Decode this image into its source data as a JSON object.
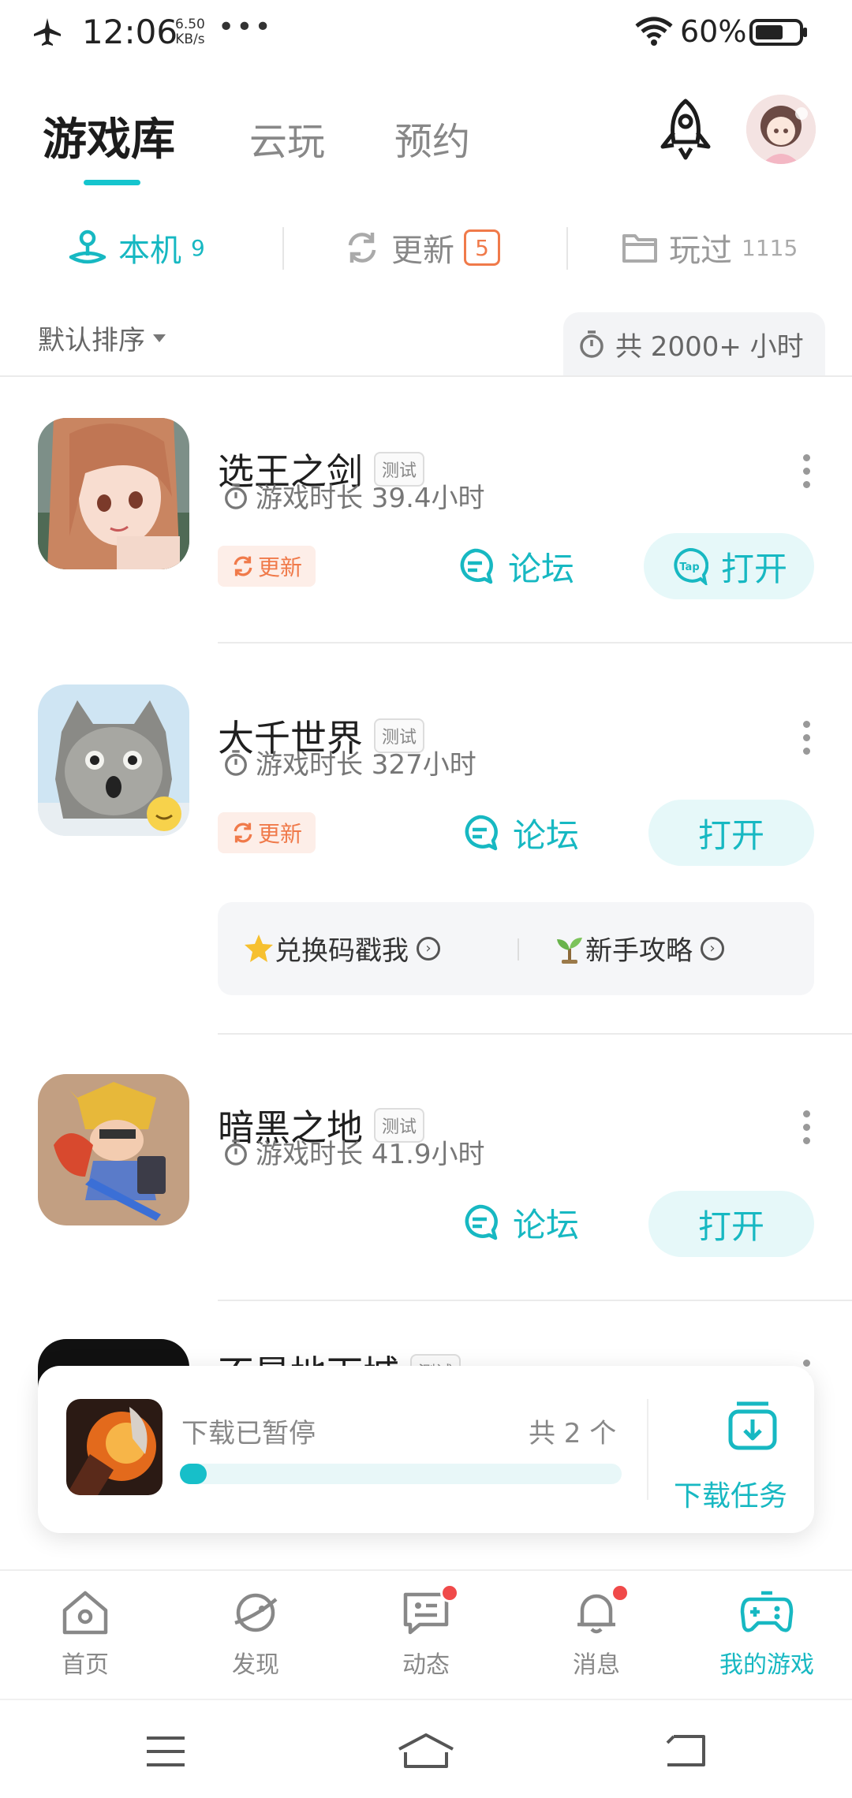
{
  "status_bar": {
    "time": "12:06",
    "net_speed_value": "6.50",
    "net_speed_unit": "KB/s",
    "more": "•••",
    "battery_percent": "60%"
  },
  "header": {
    "tabs": [
      {
        "label": "游戏库",
        "active": true
      },
      {
        "label": "云玩",
        "active": false
      },
      {
        "label": "预约",
        "active": false
      }
    ],
    "icons": {
      "launch": "rocket-icon",
      "avatar": "user-avatar"
    }
  },
  "sub_tabs": {
    "local": {
      "label": "本机",
      "count": "9"
    },
    "update": {
      "label": "更新",
      "count": "5"
    },
    "played": {
      "label": "玩过",
      "count": "1115"
    }
  },
  "sort": {
    "label": "默认排序",
    "total_time": "共 2000+ 小时"
  },
  "games": [
    {
      "name": "选王之剑",
      "tag": "测试",
      "playtime": "游戏时长 39.4小时",
      "update_label": "更新",
      "forum_label": "论坛",
      "open_label": "打开"
    },
    {
      "name": "大千世界",
      "tag": "测试",
      "playtime": "游戏时长 327小时",
      "update_label": "更新",
      "forum_label": "论坛",
      "open_label": "打开",
      "links": [
        {
          "label": "兑换码戳我"
        },
        {
          "label": "新手攻略"
        }
      ]
    },
    {
      "name": "暗黑之地",
      "tag": "测试",
      "playtime": "游戏时长 41.9小时",
      "forum_label": "论坛",
      "open_label": "打开"
    },
    {
      "name": "不是地下城",
      "tag": "测试"
    }
  ],
  "download": {
    "status": "下载已暂停",
    "count": "共 2 个",
    "progress": 0.05,
    "task_label": "下载任务"
  },
  "bottom_nav": [
    {
      "label": "首页",
      "icon": "home-icon"
    },
    {
      "label": "发现",
      "icon": "planet-icon"
    },
    {
      "label": "动态",
      "icon": "chat-icon",
      "dot": true
    },
    {
      "label": "消息",
      "icon": "bell-icon",
      "dot": true
    },
    {
      "label": "我的游戏",
      "icon": "gamepad-icon",
      "active": true
    }
  ],
  "colors": {
    "accent": "#17b8c2",
    "update": "#f07a4a",
    "notify": "#f04a4a"
  }
}
